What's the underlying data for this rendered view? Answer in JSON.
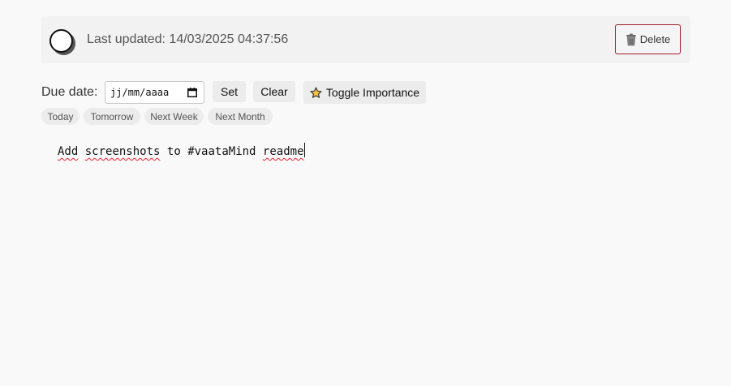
{
  "header": {
    "last_updated": "Last updated: 14/03/2025 04:37:56",
    "delete_label": "Delete"
  },
  "due": {
    "label": "Due date:",
    "date_placeholder": "jj/mm/aaaa",
    "set_label": "Set",
    "clear_label": "Clear",
    "importance_label": "Toggle Importance"
  },
  "quick_dates": [
    "Today",
    "Tomorrow",
    "Next Week",
    "Next Month"
  ],
  "note": {
    "words": [
      "Add",
      "screenshots",
      "to",
      "#vaataMind",
      "readme"
    ]
  },
  "icons": {
    "complete": "circle-checkbox-icon",
    "delete": "trash-icon",
    "calendar": "calendar-icon",
    "importance": "star-icon"
  },
  "colors": {
    "delete_border": "#a31a2c",
    "star_fill": "#f6c343",
    "spellcheck": "#e23"
  }
}
